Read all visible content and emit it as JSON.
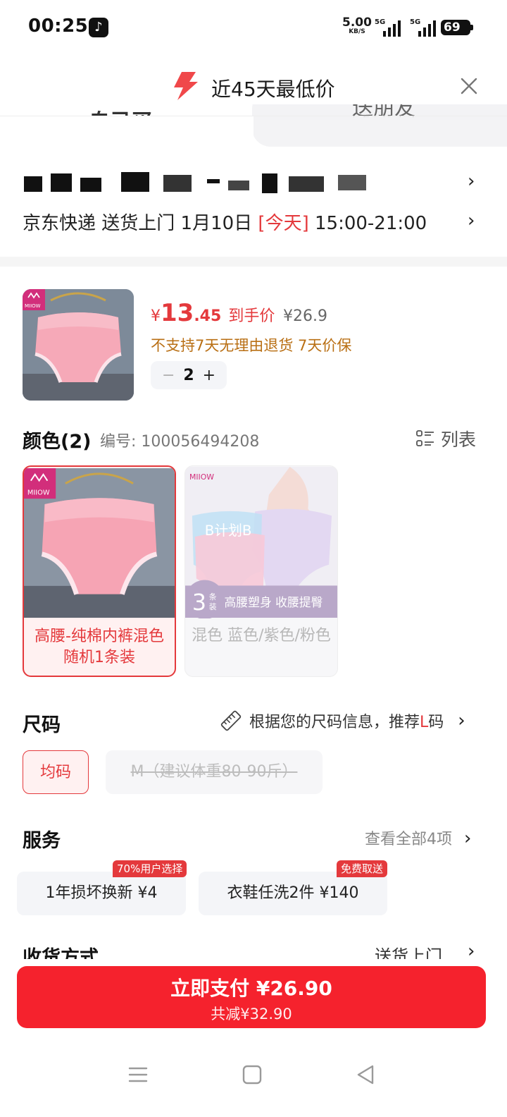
{
  "status_bar": {
    "time": "00:25",
    "net_speed_value": "5.00",
    "net_speed_unit": "KB/S",
    "signal_1_label": "5G",
    "signal_2_label": "5G",
    "battery": "69"
  },
  "banner": {
    "title": "近45天最低价"
  },
  "tabs": {
    "left": "自己买",
    "right": "送朋友"
  },
  "delivery": {
    "line_prefix": "京东快递 送货上门 1月10日 ",
    "today": "[今天]",
    "time_window": " 15:00-21:00"
  },
  "product": {
    "currency": "¥",
    "price_int": "13",
    "price_dec": ".45",
    "price_label": "到手价",
    "original_price": "¥26.9",
    "policy": "不支持7天无理由退货  7天价保",
    "quantity": "2",
    "minus": "−",
    "plus": "+"
  },
  "color_section": {
    "title": "颜色(2)",
    "sku": "编号: 100056494208",
    "list_label": "列表",
    "options": [
      {
        "label": "高腰-纯棉内裤混色随机1条装",
        "state": "selected"
      },
      {
        "label": "混色 蓝色/紫色/粉色",
        "state": "disabled"
      }
    ],
    "promo_overlay": {
      "brand": "MIIOW",
      "plan": "B计划B",
      "count": "3",
      "count_unit_1": "条",
      "count_unit_2": "装",
      "slogan": "高腰塑身 收腰提臀"
    }
  },
  "size_section": {
    "title": "尺码",
    "tip_prefix": "根据您的尺码信息，推荐",
    "tip_size": "L",
    "tip_suffix": "码",
    "options": [
      {
        "label": "均码",
        "state": "selected"
      },
      {
        "label": "M（建议体重80-90斤）",
        "state": "disabled"
      }
    ]
  },
  "service_section": {
    "title": "服务",
    "see_all": "查看全部4项",
    "items": [
      {
        "label": "1年损坏换新  ¥4",
        "badge": "70%用户选择"
      },
      {
        "label": "衣鞋任洗2件  ¥140",
        "badge": "免费取送"
      }
    ]
  },
  "receive_section": {
    "title": "收货方式",
    "value": "送货上门"
  },
  "pay": {
    "main": "立即支付 ¥26.90",
    "sub": "共减¥32.90"
  },
  "colors": {
    "accent_red": "#e4393c",
    "pay_button": "#f5222d",
    "policy_orange": "#b96f14"
  }
}
